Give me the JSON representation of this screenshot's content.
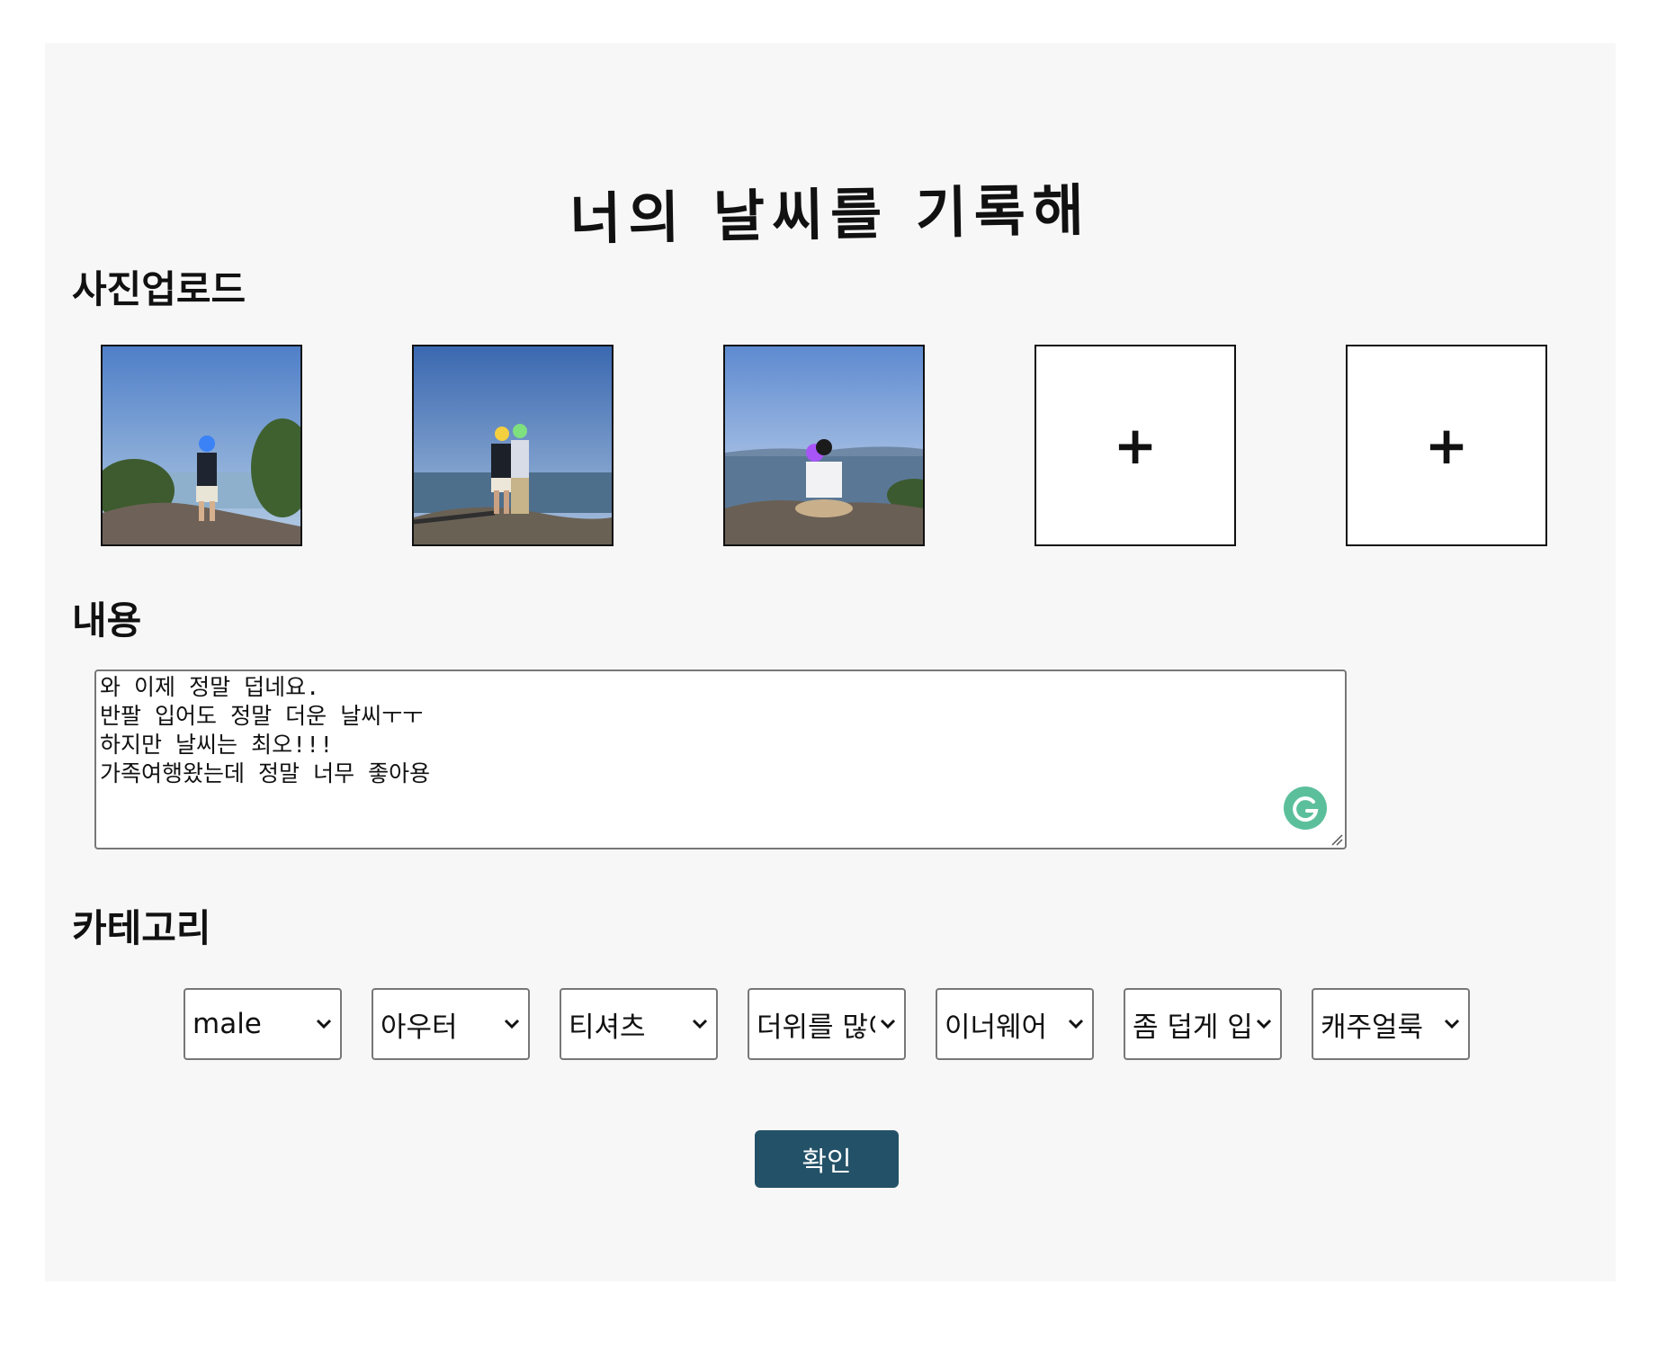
{
  "page": {
    "title": "너의 날씨를 기록해"
  },
  "sections": {
    "photo_upload": "사진업로드",
    "content": "내용",
    "category": "카테고리"
  },
  "photos": {
    "add_label": "+",
    "items": [
      {
        "type": "photo"
      },
      {
        "type": "photo"
      },
      {
        "type": "photo"
      },
      {
        "type": "add"
      },
      {
        "type": "add"
      }
    ]
  },
  "content": {
    "lines": [
      "와 이제 정말 덥네요.",
      "반팔 입어도 정말 더운 날씨ㅜㅜ",
      "하지만 날씨는 최오!!!",
      "가족여행왔는데 정말 너무 좋아용"
    ]
  },
  "categories": {
    "selects": [
      "male",
      "아우터",
      "티셔츠",
      "더위를 많이",
      "이너웨어",
      "좀 덥게 입",
      "캐주얼룩"
    ]
  },
  "actions": {
    "confirm_label": "확인"
  },
  "colors": {
    "panel_bg": "#f7f7f7",
    "confirm_bg": "#235268",
    "grammarly": "#5cbf9c"
  }
}
